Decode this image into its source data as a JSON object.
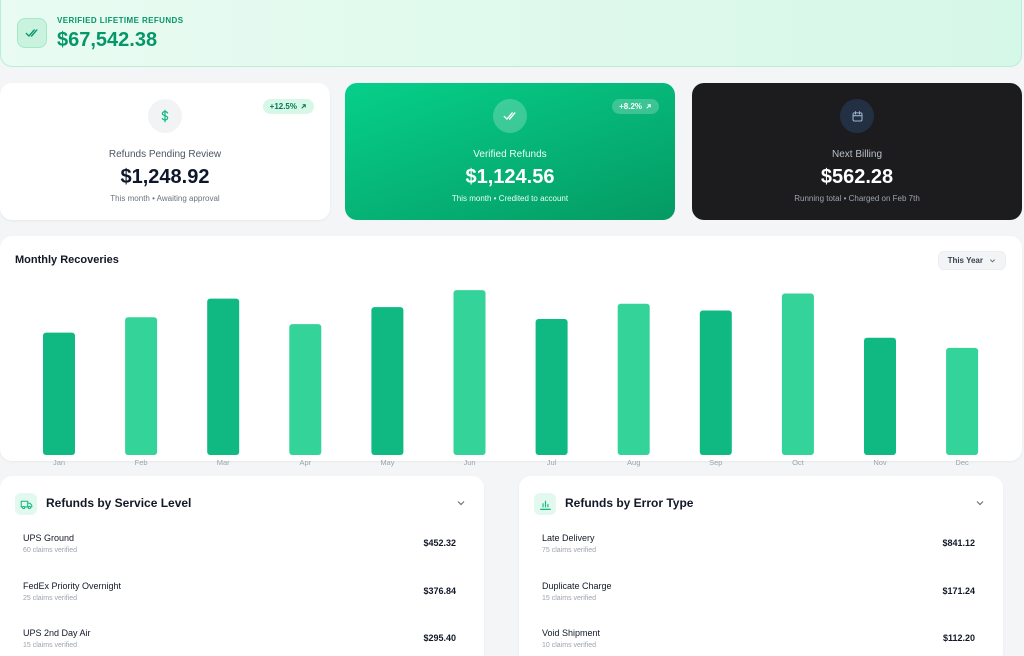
{
  "hero": {
    "label": "VERIFIED LIFETIME REFUNDS",
    "value": "$67,542.38"
  },
  "stats": [
    {
      "label": "Refunds Pending Review",
      "value": "$1,248.92",
      "sub": "This month • Awaiting approval",
      "badge": "+12.5%",
      "icon": "dollar-icon"
    },
    {
      "label": "Verified Refunds",
      "value": "$1,124.56",
      "sub": "This month • Credited to account",
      "badge": "+8.2%",
      "icon": "double-check-icon"
    },
    {
      "label": "Next Billing",
      "value": "$562.28",
      "sub": "Running total • Charged on Feb 7th",
      "icon": "calendar-icon"
    }
  ],
  "chart": {
    "title": "Monthly Recoveries",
    "range_select": "This Year"
  },
  "chart_data": {
    "type": "bar",
    "title": "Monthly Recoveries",
    "categories": [
      "Jan",
      "Feb",
      "Mar",
      "Apr",
      "May",
      "Jun",
      "Jul",
      "Aug",
      "Sep",
      "Oct",
      "Nov",
      "Dec"
    ],
    "values": [
      72,
      81,
      92,
      77,
      87,
      97,
      80,
      89,
      85,
      95,
      69,
      63
    ],
    "ylim": [
      0,
      100
    ],
    "grid": false,
    "colors": [
      "#10b981",
      "#34d399"
    ]
  },
  "service_panel": {
    "title": "Refunds by Service Level",
    "rows": [
      {
        "name": "UPS Ground",
        "sub": "60 claims verified",
        "amount": "$452.32"
      },
      {
        "name": "FedEx Priority Overnight",
        "sub": "25 claims verified",
        "amount": "$376.84"
      },
      {
        "name": "UPS 2nd Day Air",
        "sub": "15 claims verified",
        "amount": "$295.40"
      }
    ]
  },
  "error_panel": {
    "title": "Refunds by Error Type",
    "rows": [
      {
        "name": "Late Delivery",
        "sub": "75 claims verified",
        "amount": "$841.12"
      },
      {
        "name": "Duplicate Charge",
        "sub": "15 claims verified",
        "amount": "$171.24"
      },
      {
        "name": "Void Shipment",
        "sub": "10 claims verified",
        "amount": "$112.20"
      }
    ]
  },
  "colors": {
    "accent": "#10b981",
    "accent_light": "#34d399",
    "dark_card": "#1c1c1e"
  }
}
